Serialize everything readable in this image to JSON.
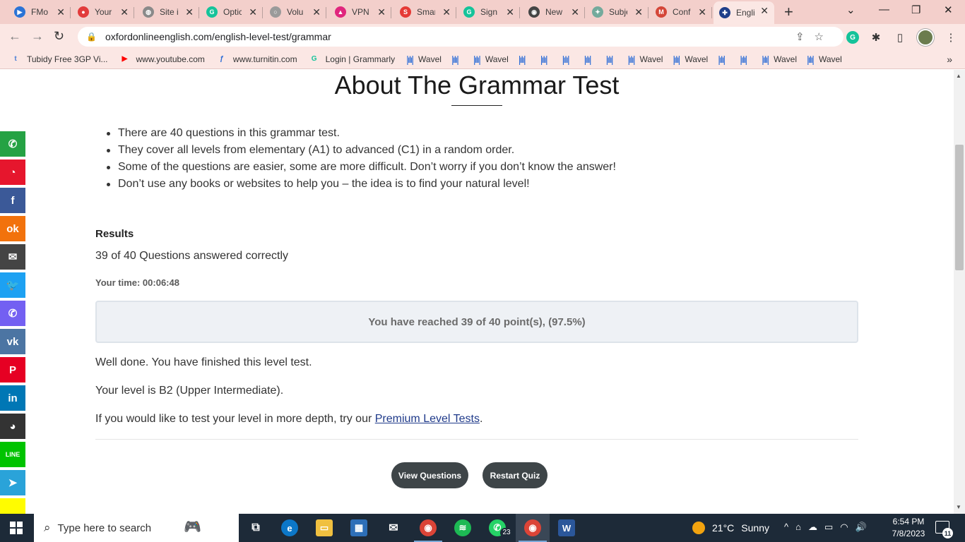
{
  "browser": {
    "tabs": [
      {
        "label": "FMo",
        "icon": "fmovies-icon",
        "color": "#2b73d6",
        "glyph": "▶"
      },
      {
        "label": "Your",
        "icon": "youtube-shorts-icon",
        "color": "#e23b3b",
        "glyph": "●"
      },
      {
        "label": "Site i",
        "icon": "globe-icon",
        "color": "#8a8a8a",
        "glyph": "◍"
      },
      {
        "label": "Optic",
        "icon": "grammarly-icon",
        "color": "#15c39a",
        "glyph": "G"
      },
      {
        "label": "Volu",
        "icon": "circle-icon",
        "color": "#9a9a9a",
        "glyph": "○"
      },
      {
        "label": "VPN",
        "icon": "vpn-icon",
        "color": "#e0267d",
        "glyph": "▲"
      },
      {
        "label": "Smar",
        "icon": "smallpdf-icon",
        "color": "#e53935",
        "glyph": "S"
      },
      {
        "label": "Sign",
        "icon": "grammarly-icon",
        "color": "#15c39a",
        "glyph": "G"
      },
      {
        "label": "New",
        "icon": "github-icon",
        "color": "#444444",
        "glyph": "◉"
      },
      {
        "label": "Subje",
        "icon": "chatgpt-icon",
        "color": "#74aa9c",
        "glyph": "✦"
      },
      {
        "label": "Conf",
        "icon": "gmail-icon",
        "color": "#d44638",
        "glyph": "M"
      },
      {
        "label": "Engli",
        "icon": "uk-flag-icon",
        "color": "#1e3f8a",
        "glyph": "✚",
        "active": true
      }
    ],
    "new_tab": "+",
    "url": "oxfordonlineenglish.com/english-level-test/grammar",
    "bookmarks": [
      {
        "label": "Tubidy Free 3GP Vi...",
        "icon": "tubidy-icon",
        "color": "#4a7fd6",
        "glyph": "t"
      },
      {
        "label": "www.youtube.com",
        "icon": "youtube-icon",
        "color": "#ff0000",
        "glyph": "▶"
      },
      {
        "label": "www.turnitin.com",
        "icon": "turnitin-icon",
        "color": "#2a6bd6",
        "glyph": "ƒ"
      },
      {
        "label": "Login | Grammarly",
        "icon": "grammarly-icon",
        "color": "#15c39a",
        "glyph": "G"
      }
    ],
    "wavel_items": [
      "Wavel",
      "",
      "Wavel",
      "",
      "",
      "",
      "",
      "",
      "Wavel",
      "Wavel",
      "",
      "",
      "Wavel",
      "Wavel"
    ]
  },
  "page": {
    "title": "About The Grammar Test",
    "bullets": [
      "There are 40 questions in this grammar test.",
      "They cover all levels from elementary (A1) to advanced (C1) in a random order.",
      "Some of the questions are easier, some are more difficult. Don’t worry if you don’t know the answer!",
      "Don’t use any books or websites to help you – the idea is to find your natural level!"
    ],
    "results_heading": "Results",
    "answered": "39 of 40 Questions answered correctly",
    "your_time": "Your time: 00:06:48",
    "score_message": "You have reached 39 of 40 point(s), (97.5%)",
    "finished": "Well done. You have finished this level test.",
    "level": "Your level is B2 (Upper Intermediate).",
    "depth_prefix": "If you would like to test your level in more depth, try our ",
    "depth_link": "Premium Level Tests",
    "depth_suffix": ".",
    "view_questions": "View Questions",
    "restart_quiz": "Restart Quiz"
  },
  "social": [
    {
      "name": "whatsapp-share-icon",
      "color": "#25a244",
      "glyph": "✆"
    },
    {
      "name": "weibo-share-icon",
      "color": "#e6162d",
      "glyph": "◔"
    },
    {
      "name": "facebook-share-icon",
      "color": "#3b5998",
      "glyph": "f"
    },
    {
      "name": "odnoklassniki-share-icon",
      "color": "#f2720c",
      "glyph": "ok"
    },
    {
      "name": "email-share-icon",
      "color": "#444444",
      "glyph": "✉"
    },
    {
      "name": "twitter-share-icon",
      "color": "#1da1f2",
      "glyph": "🐦"
    },
    {
      "name": "viber-share-icon",
      "color": "#7360f2",
      "glyph": "✆"
    },
    {
      "name": "vk-share-icon",
      "color": "#4c75a3",
      "glyph": "vk"
    },
    {
      "name": "pinterest-share-icon",
      "color": "#e60023",
      "glyph": "P"
    },
    {
      "name": "linkedin-share-icon",
      "color": "#0077b5",
      "glyph": "in"
    },
    {
      "name": "reddit-share-icon",
      "color": "#333333",
      "glyph": "◕"
    },
    {
      "name": "line-share-icon",
      "color": "#00c300",
      "glyph": "LINE"
    },
    {
      "name": "telegram-share-icon",
      "color": "#2aa3d9",
      "glyph": "➤"
    },
    {
      "name": "snapchat-share-icon",
      "color": "#fffc00",
      "glyph": ""
    }
  ],
  "taskbar": {
    "search_placeholder": "Type here to search",
    "whatsapp_badge": "23",
    "weather_temp": "21°C",
    "weather_cond": "Sunny",
    "time": "6:54 PM",
    "date": "7/8/2023",
    "notification_count": "11"
  }
}
